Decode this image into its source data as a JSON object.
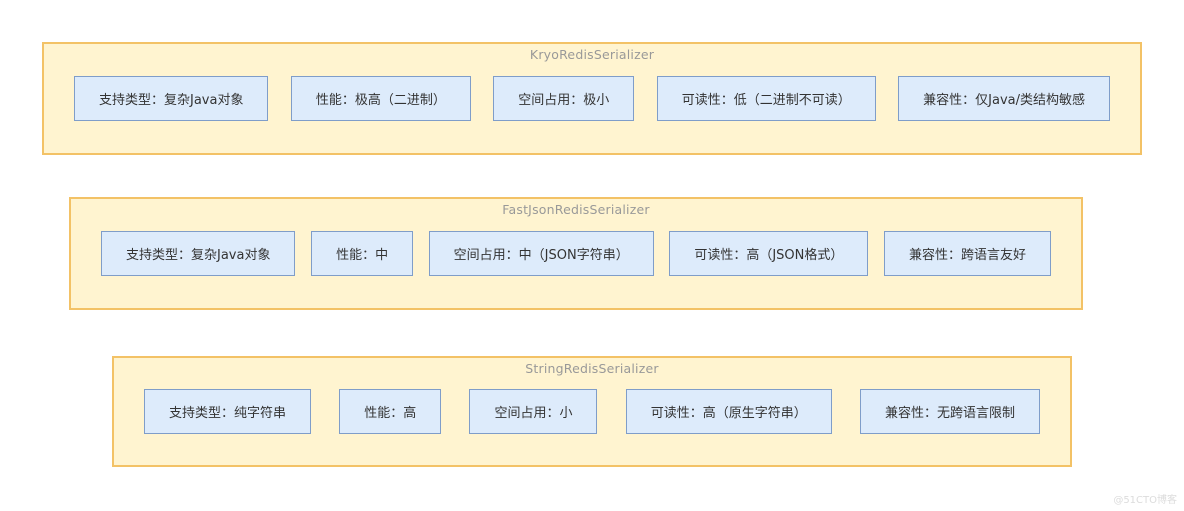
{
  "diagram": {
    "groups": [
      {
        "title": "KryoRedisSerializer",
        "items": [
          "支持类型：复杂Java对象",
          "性能：极高（二进制）",
          "空间占用：极小",
          "可读性：低（二进制不可读）",
          "兼容性：仅Java/类结构敏感"
        ]
      },
      {
        "title": "FastJsonRedisSerializer",
        "items": [
          "支持类型：复杂Java对象",
          "性能：中",
          "空间占用：中（JSON字符串）",
          "可读性：高（JSON格式）",
          "兼容性：跨语言友好"
        ]
      },
      {
        "title": "StringRedisSerializer",
        "items": [
          "支持类型：纯字符串",
          "性能：高",
          "空间占用：小",
          "可读性：高（原生字符串）",
          "兼容性：无跨语言限制"
        ]
      }
    ],
    "colors": {
      "group_fill": "#FFF4D0",
      "group_border": "#F3C266",
      "node_fill": "#DDEBFB",
      "node_border": "#7F9DC9",
      "group_title_text": "#999999",
      "node_text": "#333333"
    }
  },
  "watermark": "@51CTO博客"
}
